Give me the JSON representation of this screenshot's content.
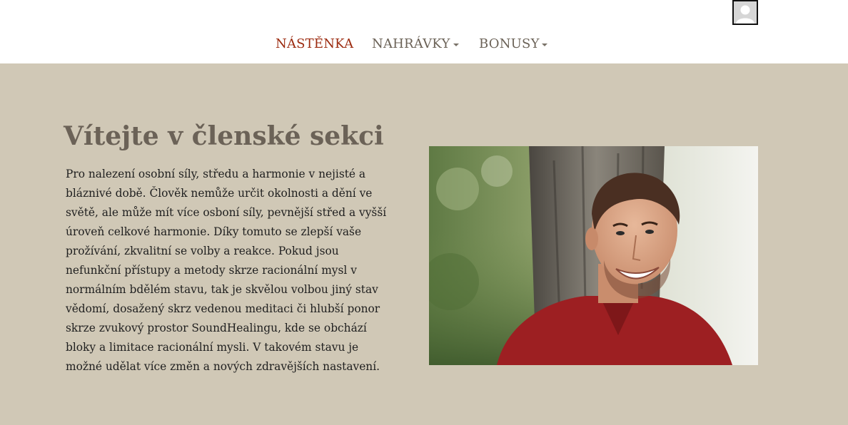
{
  "header": {
    "nav": [
      {
        "label": "NÁSTĚNKA",
        "active": true,
        "has_dropdown": false
      },
      {
        "label": "NAHRÁVKY",
        "active": false,
        "has_dropdown": true
      },
      {
        "label": "BONUSY",
        "active": false,
        "has_dropdown": true
      }
    ],
    "avatar_icon": "user-avatar-icon"
  },
  "main": {
    "heading": "Vítejte v členské sekci",
    "paragraph": "Pro nalezení osobní síly, středu a harmonie v nejisté a bláznivé době. Člověk nemůže určit okolnosti a dění ve světě, ale může mít více osboní síly, pevnější střed a vyšší úroveň celkové harmonie. Díky tomuto se zlepší vaše prožívání, zkvalitní se volby a reakce. Pokud jsou nefunkční přístupy a metody skrze racionální mysl v normálním bdělém stavu, tak je skvělou volbou jiný stav vědomí, dosažený skrz vedenou meditaci či hlubší ponor skrze zvukový prostor SoundHealingu, kde se obchází bloky a limitace racionální mysli. V takovém stavu je možné udělat více změn a nových zdravějších nastavení."
  },
  "colors": {
    "nav_active": "#9c2b10",
    "nav_default": "#6b6257",
    "content_background": "#d0c8b6",
    "heading": "#6b6257",
    "body_text": "#1f1f1f"
  }
}
